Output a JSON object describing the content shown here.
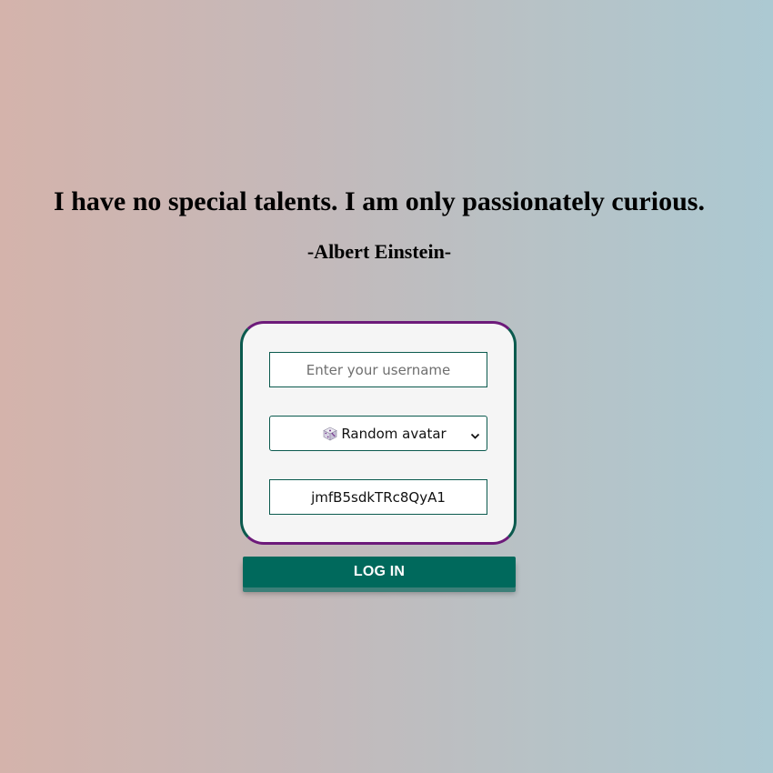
{
  "quote": {
    "text": "I have no special talents. I am only passionately curious.",
    "author": "-Albert Einstein-"
  },
  "form": {
    "username_placeholder": "Enter your username",
    "username_value": "",
    "avatar_select": {
      "selected": "Random avatar",
      "icon": "dice-icon"
    },
    "password_value": "jmfB5sdkTRc8QyA1"
  },
  "login_button": {
    "label": "LOG IN"
  },
  "colors": {
    "accent": "#00695c",
    "card_border_purple": "#6d1a7a",
    "card_border_green": "#0b5a4e",
    "background_left": "#d4b3ab",
    "background_right": "#acc9d2"
  }
}
